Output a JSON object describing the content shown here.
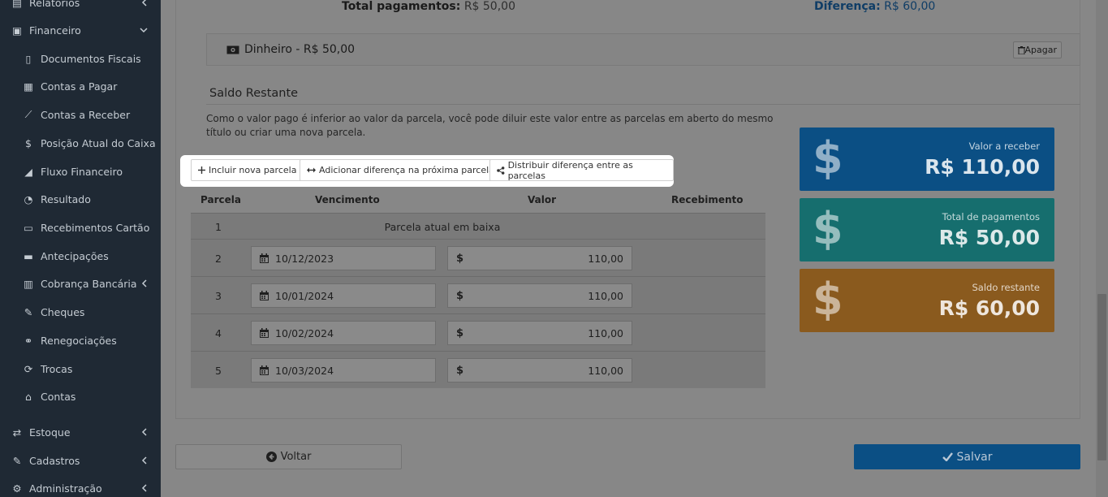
{
  "sidebar": {
    "items": [
      {
        "label": "Relatórios",
        "level": "top",
        "icon": "chart-icon",
        "chevron": "left"
      },
      {
        "label": "Financeiro",
        "level": "top",
        "icon": "money-icon",
        "chevron": "down"
      },
      {
        "label": "Documentos Fiscais",
        "level": "sub",
        "icon": "file-icon"
      },
      {
        "label": "Contas a Pagar",
        "level": "sub",
        "icon": "calculator-icon"
      },
      {
        "label": "Contas a Receber",
        "level": "sub",
        "icon": "line-chart-icon"
      },
      {
        "label": "Posição Atual do Caixa",
        "level": "sub",
        "icon": "dollar-icon"
      },
      {
        "label": "Fluxo Financeiro",
        "level": "sub",
        "icon": "area-chart-icon"
      },
      {
        "label": "Resultado",
        "level": "sub",
        "icon": "pie-chart-icon"
      },
      {
        "label": "Recebimentos Cartão",
        "level": "sub",
        "icon": "credit-card-icon"
      },
      {
        "label": "Antecipações",
        "level": "sub",
        "icon": "wallet-icon"
      },
      {
        "label": "Cobrança Bancária",
        "level": "sub",
        "icon": "barcode-icon",
        "chevron": "left"
      },
      {
        "label": "Cheques",
        "level": "sub",
        "icon": "edit-icon"
      },
      {
        "label": "Renegociações",
        "level": "sub",
        "icon": "handshake-icon"
      },
      {
        "label": "Trocas",
        "level": "sub",
        "icon": "refresh-icon"
      },
      {
        "label": "Contas",
        "level": "sub",
        "icon": "bank-icon"
      },
      {
        "label": "Estoque",
        "level": "top",
        "icon": "exchange-icon",
        "chevron": "left"
      },
      {
        "label": "Cadastros",
        "level": "top",
        "icon": "edit-icon",
        "chevron": "left"
      },
      {
        "label": "Administração",
        "level": "top",
        "icon": "cogs-icon",
        "chevron": "left"
      }
    ]
  },
  "totals": {
    "pagamentos_label": "Total pagamentos:",
    "pagamentos_value": "R$ 50,00",
    "diferenca_label": "Diferença:",
    "diferenca_value": "R$ 60,00"
  },
  "payment": {
    "text": "Dinheiro - R$ 50,00",
    "delete_label": "Apagar"
  },
  "saldo": {
    "title": "Saldo Restante",
    "description": "Como o valor pago é inferior ao valor da parcela, você pode diluir este valor entre as parcelas em aberto do mesmo título ou criar uma nova parcela."
  },
  "actions": {
    "incluir": "Incluir nova parcela",
    "adicionar": "Adicionar diferença na próxima parcela",
    "distribuir": "Distribuir diferença entre as parcelas"
  },
  "table": {
    "headers": [
      "Parcela",
      "Vencimento",
      "Valor",
      "Recebimento"
    ],
    "current_row": {
      "num": "1",
      "text": "Parcela atual em baixa"
    },
    "rows": [
      {
        "num": "2",
        "date": "10/12/2023",
        "currency": "$",
        "value": "110,00"
      },
      {
        "num": "3",
        "date": "10/01/2024",
        "currency": "$",
        "value": "110,00"
      },
      {
        "num": "4",
        "date": "10/02/2024",
        "currency": "$",
        "value": "110,00"
      },
      {
        "num": "5",
        "date": "10/03/2024",
        "currency": "$",
        "value": "110,00"
      }
    ]
  },
  "summary": [
    {
      "label": "Valor a receber",
      "value": "R$ 110,00",
      "color": "#0b4f84"
    },
    {
      "label": "Total de pagamentos",
      "value": "R$ 50,00",
      "color": "#166e6e"
    },
    {
      "label": "Saldo restante",
      "value": "R$ 60,00",
      "color": "#8a5a1e"
    }
  ],
  "footer": {
    "back_label": "Voltar",
    "save_label": "Salvar"
  }
}
